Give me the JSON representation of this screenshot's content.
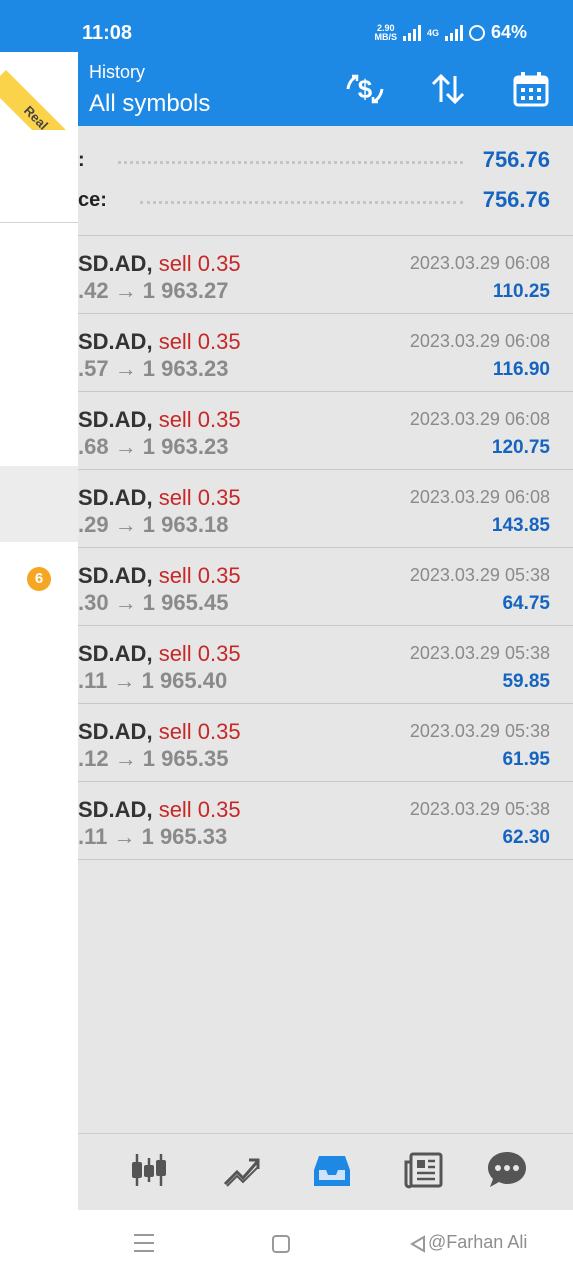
{
  "status_bar": {
    "time": "11:08",
    "net_speed_value": "2.90",
    "net_speed_unit": "MB/S",
    "network": "4G",
    "battery": "64%"
  },
  "app_bar": {
    "title": "History",
    "subtitle": "All symbols",
    "icons": [
      "currency-exchange-icon",
      "sort-icon",
      "calendar-icon"
    ]
  },
  "ribbon": {
    "label": "Real"
  },
  "drawer": {
    "badge_count": "6"
  },
  "summary": [
    {
      "label": ":",
      "value": "756.76"
    },
    {
      "label": "ce:",
      "value": "756.76"
    }
  ],
  "deals": [
    {
      "symbol": "SD.AD,",
      "action": "sell 0.35",
      "prices": ".42 → 1 963.27",
      "time": "2023.03.29 06:08",
      "profit": "110.25"
    },
    {
      "symbol": "SD.AD,",
      "action": "sell 0.35",
      "prices": ".57 → 1 963.23",
      "time": "2023.03.29 06:08",
      "profit": "116.90"
    },
    {
      "symbol": "SD.AD,",
      "action": "sell 0.35",
      "prices": ".68 → 1 963.23",
      "time": "2023.03.29 06:08",
      "profit": "120.75"
    },
    {
      "symbol": "SD.AD,",
      "action": "sell 0.35",
      "prices": ".29 → 1 963.18",
      "time": "2023.03.29 06:08",
      "profit": "143.85"
    },
    {
      "symbol": "SD.AD,",
      "action": "sell 0.35",
      "prices": ".30 → 1 965.45",
      "time": "2023.03.29 05:38",
      "profit": "64.75"
    },
    {
      "symbol": "SD.AD,",
      "action": "sell 0.35",
      "prices": ".11 → 1 965.40",
      "time": "2023.03.29 05:38",
      "profit": "59.85"
    },
    {
      "symbol": "SD.AD,",
      "action": "sell 0.35",
      "prices": ".12 → 1 965.35",
      "time": "2023.03.29 05:38",
      "profit": "61.95"
    },
    {
      "symbol": "SD.AD,",
      "action": "sell 0.35",
      "prices": ".11 → 1 965.33",
      "time": "2023.03.29 05:38",
      "profit": "62.30"
    }
  ],
  "tabs": [
    "quotes-icon",
    "chart-icon",
    "history-icon",
    "news-icon",
    "chat-icon"
  ],
  "active_tab": "history-icon",
  "colors": {
    "accent": "#1e88e5",
    "sell": "#c62828",
    "profit": "#1565c0",
    "badge": "#f5a623",
    "ribbon": "#fbd34a"
  },
  "watermark": "@Farhan Ali"
}
